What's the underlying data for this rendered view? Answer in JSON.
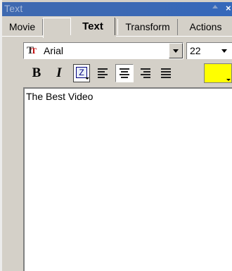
{
  "panel": {
    "title": "Text"
  },
  "tabs": [
    {
      "label": "Movie"
    },
    {
      "label": "Text"
    },
    {
      "label": "Transform"
    },
    {
      "label": "Actions"
    }
  ],
  "font": {
    "icon": "truetype-font-icon",
    "name": "Arial",
    "size": "22"
  },
  "format": {
    "bold_label": "B",
    "italic_label": "I",
    "border_color_label": "Z",
    "fill_color": "#ffff00",
    "active_alignment": "center"
  },
  "editor": {
    "content": "The Best Video"
  },
  "colors": {
    "titlebar": "#3b69b5",
    "background": "#d4d0c8",
    "swatch": "#ffff00"
  }
}
